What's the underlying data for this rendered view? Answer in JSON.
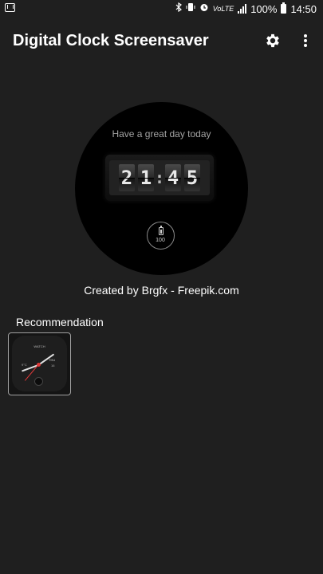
{
  "status_bar": {
    "battery_percent": "100%",
    "time": "14:50",
    "network_label": "VoLTE",
    "icons": [
      "gmail-icon",
      "bluetooth-icon",
      "vibrate-icon",
      "alarm-icon",
      "volte-icon",
      "signal-icon",
      "battery-icon"
    ]
  },
  "app_bar": {
    "title": "Digital Clock Screensaver",
    "actions": [
      "gear-icon",
      "more-vert-icon"
    ]
  },
  "preview": {
    "greeting": "Have a great day today",
    "digits": [
      "2",
      "1",
      "4",
      "5"
    ],
    "separator": ":",
    "battery_level": "100"
  },
  "credit": "Created by Brgfx - Freepik.com",
  "recommendation": {
    "title": "Recommendation",
    "thumbnail": {
      "brand": "WATCH",
      "left_value": "9°C",
      "right_label": "THU",
      "right_value": "16"
    }
  },
  "colors": {
    "background": "#1f1f1f",
    "clock_face": "#000000",
    "accent_red": "#e03a3a"
  }
}
